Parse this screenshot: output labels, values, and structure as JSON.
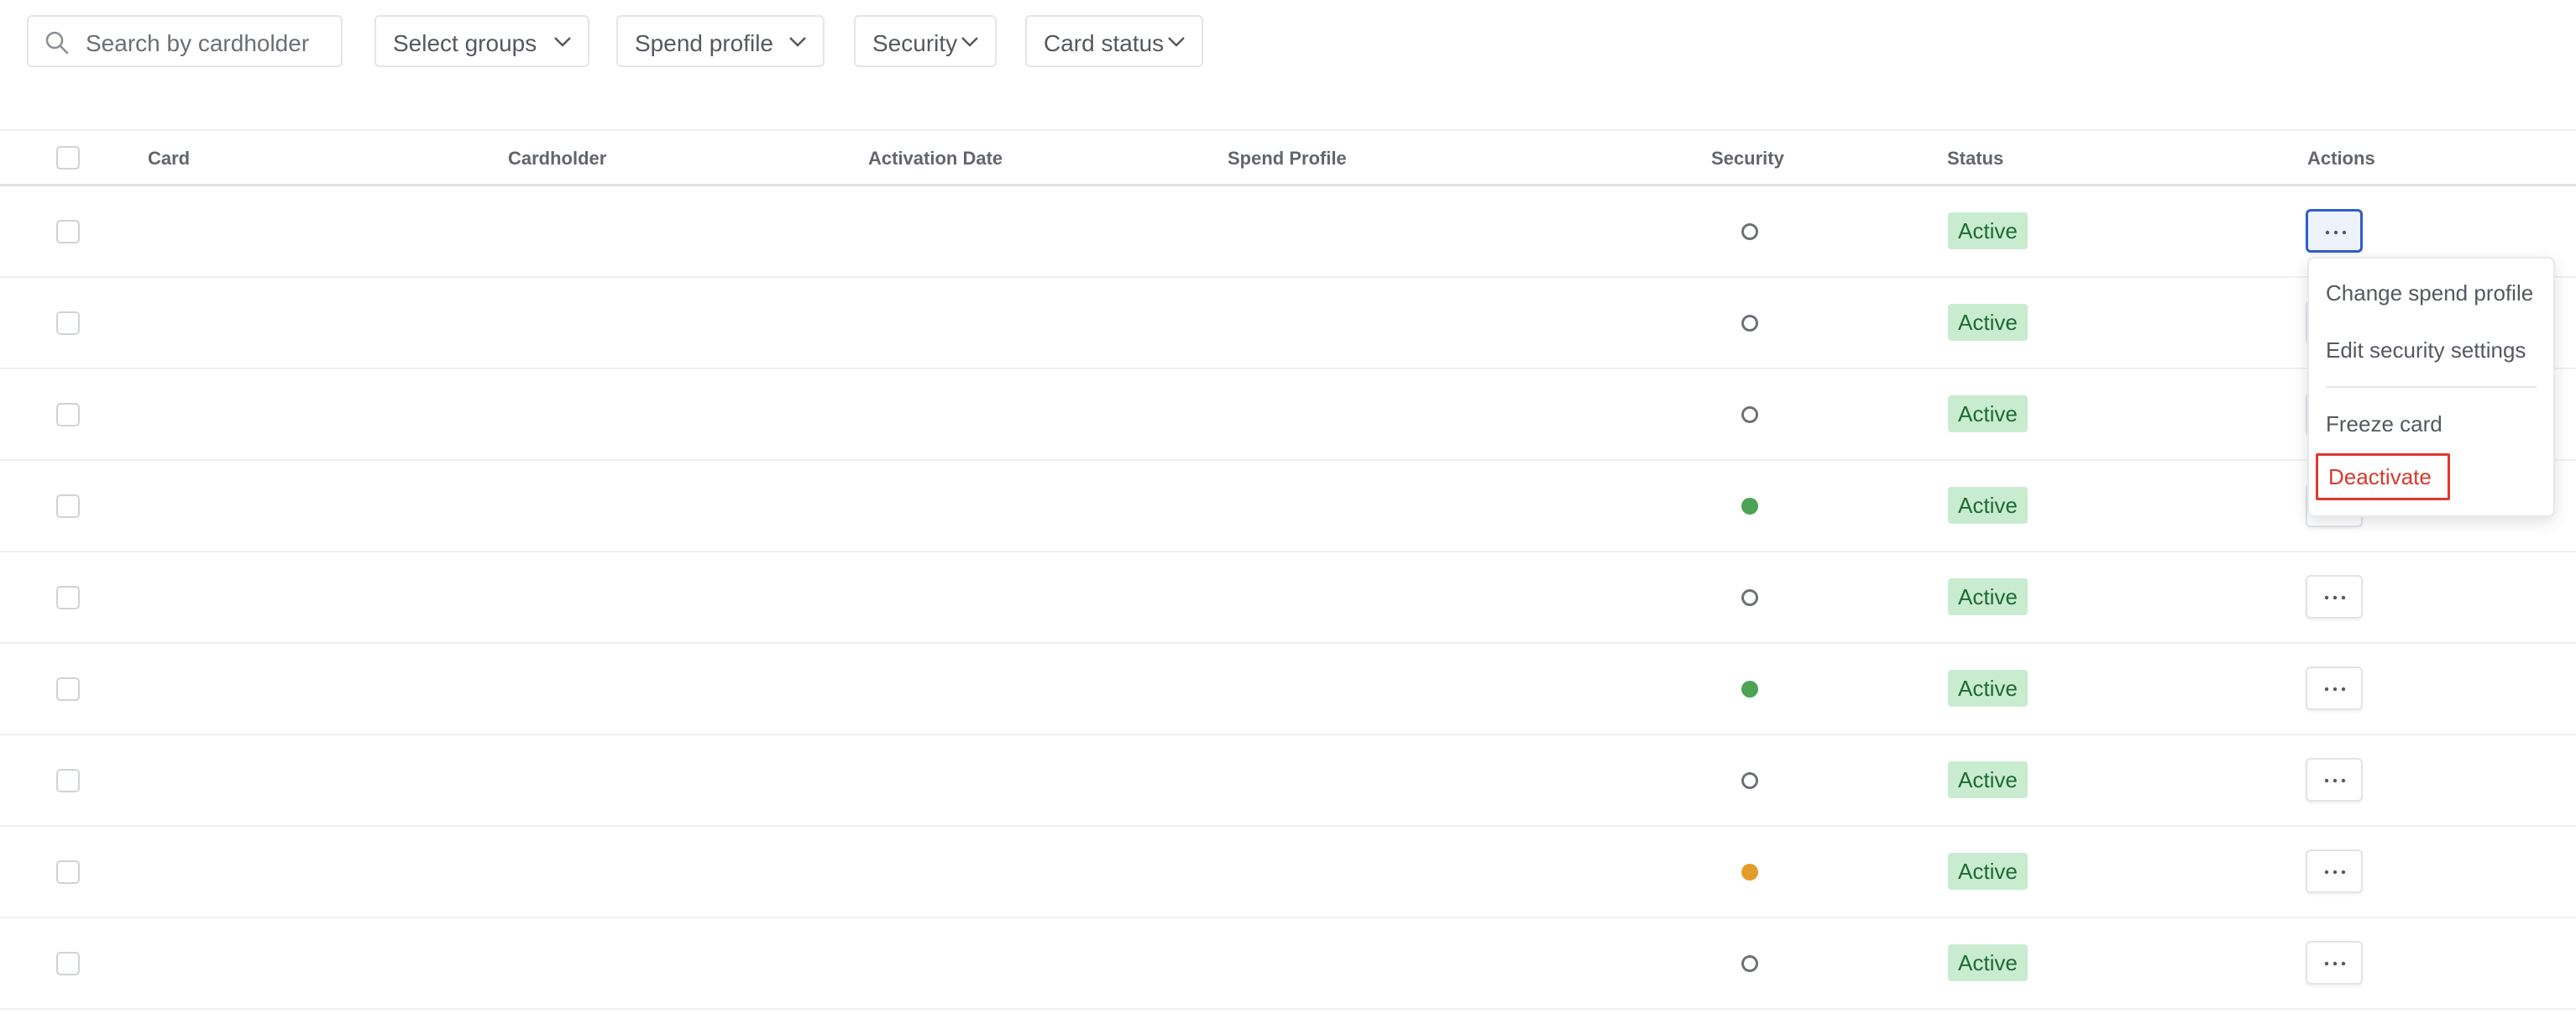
{
  "filters": {
    "search_placeholder": "Search by cardholder",
    "groups_label": "Select groups",
    "spend_profile_label": "Spend profile",
    "security_label": "Security",
    "card_status_label": "Card status"
  },
  "table": {
    "headers": {
      "card": "Card",
      "cardholder": "Cardholder",
      "activation_date": "Activation Date",
      "spend_profile": "Spend Profile",
      "security": "Security",
      "status": "Status",
      "actions": "Actions"
    },
    "rows": [
      {
        "security": "outline",
        "status": "Active"
      },
      {
        "security": "outline",
        "status": "Active"
      },
      {
        "security": "outline",
        "status": "Active"
      },
      {
        "security": "green",
        "status": "Active"
      },
      {
        "security": "outline",
        "status": "Active"
      },
      {
        "security": "green",
        "status": "Active"
      },
      {
        "security": "outline",
        "status": "Active"
      },
      {
        "security": "orange",
        "status": "Active"
      },
      {
        "security": "outline",
        "status": "Active"
      }
    ]
  },
  "menu": {
    "change_spend_profile": "Change spend profile",
    "edit_security_settings": "Edit security settings",
    "freeze_card": "Freeze card",
    "deactivate": "Deactivate"
  },
  "colors": {
    "status_active_bg": "#c9ecd1",
    "security_green": "#4aa453",
    "security_orange": "#e39b2c",
    "danger": "#d8392c",
    "focus_blue": "#2f5fc8"
  }
}
